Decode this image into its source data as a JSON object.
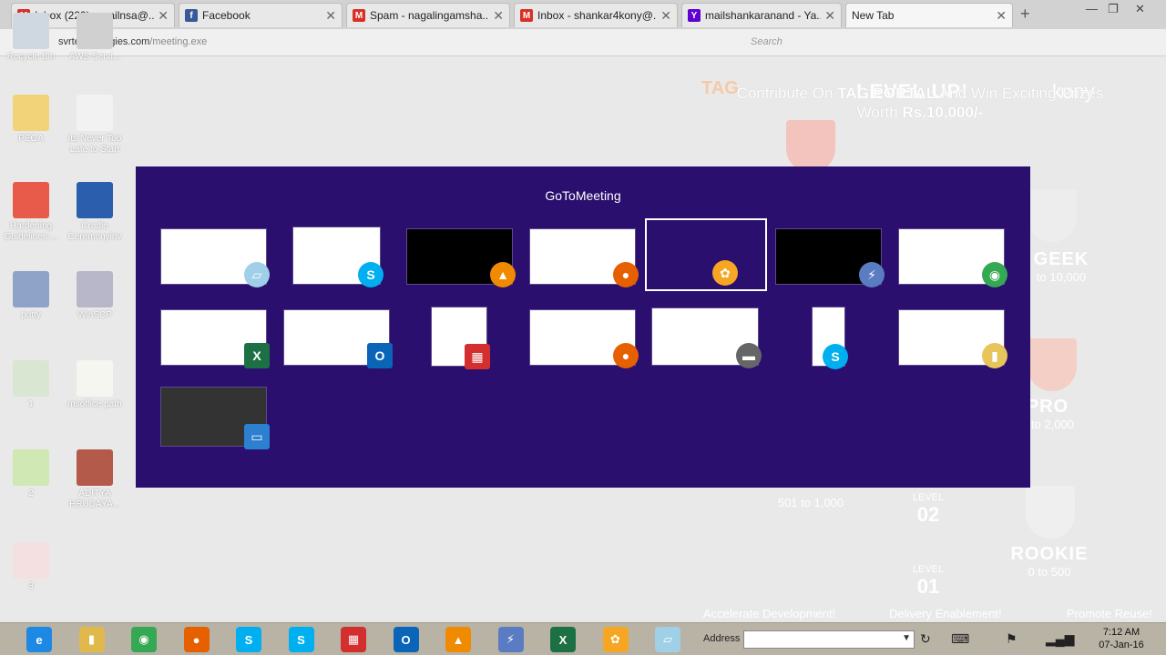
{
  "browser": {
    "tabs": [
      {
        "title": "Inbox (229) - mailnsa@...",
        "icon": "gmail-icon",
        "color": "#d93025",
        "glyph": "M"
      },
      {
        "title": "Facebook",
        "icon": "facebook-icon",
        "color": "#3b5998",
        "glyph": "f"
      },
      {
        "title": "Spam - nagalingamsha...",
        "icon": "gmail-icon",
        "color": "#d93025",
        "glyph": "M"
      },
      {
        "title": "Inbox - shankar4kony@...",
        "icon": "gmail-icon",
        "color": "#d93025",
        "glyph": "M"
      },
      {
        "title": "mailshankaranand - Ya...",
        "icon": "yahoo-icon",
        "color": "#5f01d1",
        "glyph": "Y"
      },
      {
        "title": "New Tab",
        "icon": "",
        "color": "",
        "glyph": ""
      }
    ],
    "url_host": "svrtechnologies.com",
    "url_path": "/meeting.exe",
    "search_placeholder": "Search"
  },
  "page": {
    "promo_line1_a": "Contribute On ",
    "promo_line1_b": "TAG PORTAL",
    "promo_line1_c": " And Win Exciting Prizes",
    "promo_line2_a": "Worth ",
    "promo_line2_b": "Rs.10,000/-",
    "level_up": "LEVEL UP!",
    "kony": "kony",
    "tag": "TAG",
    "ranks": [
      {
        "name": "GEEK",
        "range": "to 10,000"
      },
      {
        "name": "PRO",
        "range": "1 to 2,000"
      },
      {
        "name": "ROOKIE",
        "range": "0 to 500"
      }
    ],
    "mid_range": "501 to 1,000",
    "levels": [
      {
        "label": "LEVEL",
        "num": "02"
      },
      {
        "label": "LEVEL",
        "num": "01"
      }
    ],
    "bottom": [
      "Accelerate Development!",
      "Delivery Enablement!",
      "Promote Reuse!"
    ]
  },
  "desktop": {
    "icons": [
      {
        "label": "Recycle Bin",
        "color": "#cfd8e0"
      },
      {
        "label": "AWS Servi...",
        "color": "#d0d0d0"
      },
      {
        "label": "PEGA",
        "color": "#f3d37a"
      },
      {
        "label": "Its Never Too Late to Start",
        "color": "#f2f2f2"
      },
      {
        "label": "Hardening Guidelines-...",
        "color": "#e85b4a"
      },
      {
        "label": "Cradle Ceremonyinv",
        "color": "#2b5fad"
      },
      {
        "label": "putty",
        "color": "#8fa3c8"
      },
      {
        "label": "WinSCP",
        "color": "#b7b7c9"
      },
      {
        "label": "1",
        "color": "#d8e6d2"
      },
      {
        "label": "msoffice path",
        "color": "#f6f6f0"
      },
      {
        "label": "2",
        "color": "#cfe8b4"
      },
      {
        "label": "ADITYA HRUDAYA...",
        "color": "#b45a4a"
      },
      {
        "label": "3",
        "color": "#f4e0e0"
      }
    ]
  },
  "switcher": {
    "title": "GoToMeeting",
    "windows": [
      {
        "app": "notepad-icon",
        "color": "#9fd0e8",
        "glyph": "▱"
      },
      {
        "app": "skype-icon",
        "color": "#00aff0",
        "glyph": "S"
      },
      {
        "app": "vlc-icon",
        "color": "#f08a00",
        "glyph": "▲"
      },
      {
        "app": "firefox-icon",
        "color": "#e66000",
        "glyph": "●"
      },
      {
        "app": "gotomeeting-icon",
        "color": "#f6a623",
        "glyph": "✿"
      },
      {
        "app": "putty-icon",
        "color": "#5a7cc2",
        "glyph": "⚡"
      },
      {
        "app": "chrome-icon",
        "color": "#34a853",
        "glyph": "◉"
      },
      {
        "app": "excel-icon",
        "color": "#1d7044",
        "glyph": "X"
      },
      {
        "app": "outlook-icon",
        "color": "#0a64b8",
        "glyph": "O"
      },
      {
        "app": "fortinet-icon",
        "color": "#d32f2f",
        "glyph": "▦"
      },
      {
        "app": "firefox-icon",
        "color": "#e66000",
        "glyph": "●"
      },
      {
        "app": "chat-icon",
        "color": "#666666",
        "glyph": "▬"
      },
      {
        "app": "skype-icon",
        "color": "#00aff0",
        "glyph": "S"
      },
      {
        "app": "folder-icon",
        "color": "#e7c55a",
        "glyph": "▮"
      },
      {
        "app": "remote-desktop-icon",
        "color": "#2d7fd0",
        "glyph": "▭"
      }
    ]
  },
  "taskbar": {
    "apps": [
      {
        "name": "ie-icon",
        "color": "#1e88e5",
        "glyph": "e"
      },
      {
        "name": "explorer-icon",
        "color": "#e0b84c",
        "glyph": "▮"
      },
      {
        "name": "chrome-icon",
        "color": "#34a853",
        "glyph": "◉"
      },
      {
        "name": "firefox-icon",
        "color": "#e66000",
        "glyph": "●"
      },
      {
        "name": "skype-icon",
        "color": "#00aff0",
        "glyph": "S"
      },
      {
        "name": "skype-business-icon",
        "color": "#00aff0",
        "glyph": "S"
      },
      {
        "name": "fortinet-icon",
        "color": "#d32f2f",
        "glyph": "▦"
      },
      {
        "name": "outlook-icon",
        "color": "#0a64b8",
        "glyph": "O"
      },
      {
        "name": "vlc-icon",
        "color": "#f08a00",
        "glyph": "▲"
      },
      {
        "name": "putty-icon",
        "color": "#5a7cc2",
        "glyph": "⚡"
      },
      {
        "name": "excel-icon",
        "color": "#1d7044",
        "glyph": "X"
      },
      {
        "name": "gotomeeting-icon",
        "color": "#f6a623",
        "glyph": "✿"
      },
      {
        "name": "notepad-icon",
        "color": "#9fd0e8",
        "glyph": "▱"
      }
    ],
    "address_label": "Address",
    "time": "7:12 AM",
    "date": "07-Jan-16"
  }
}
